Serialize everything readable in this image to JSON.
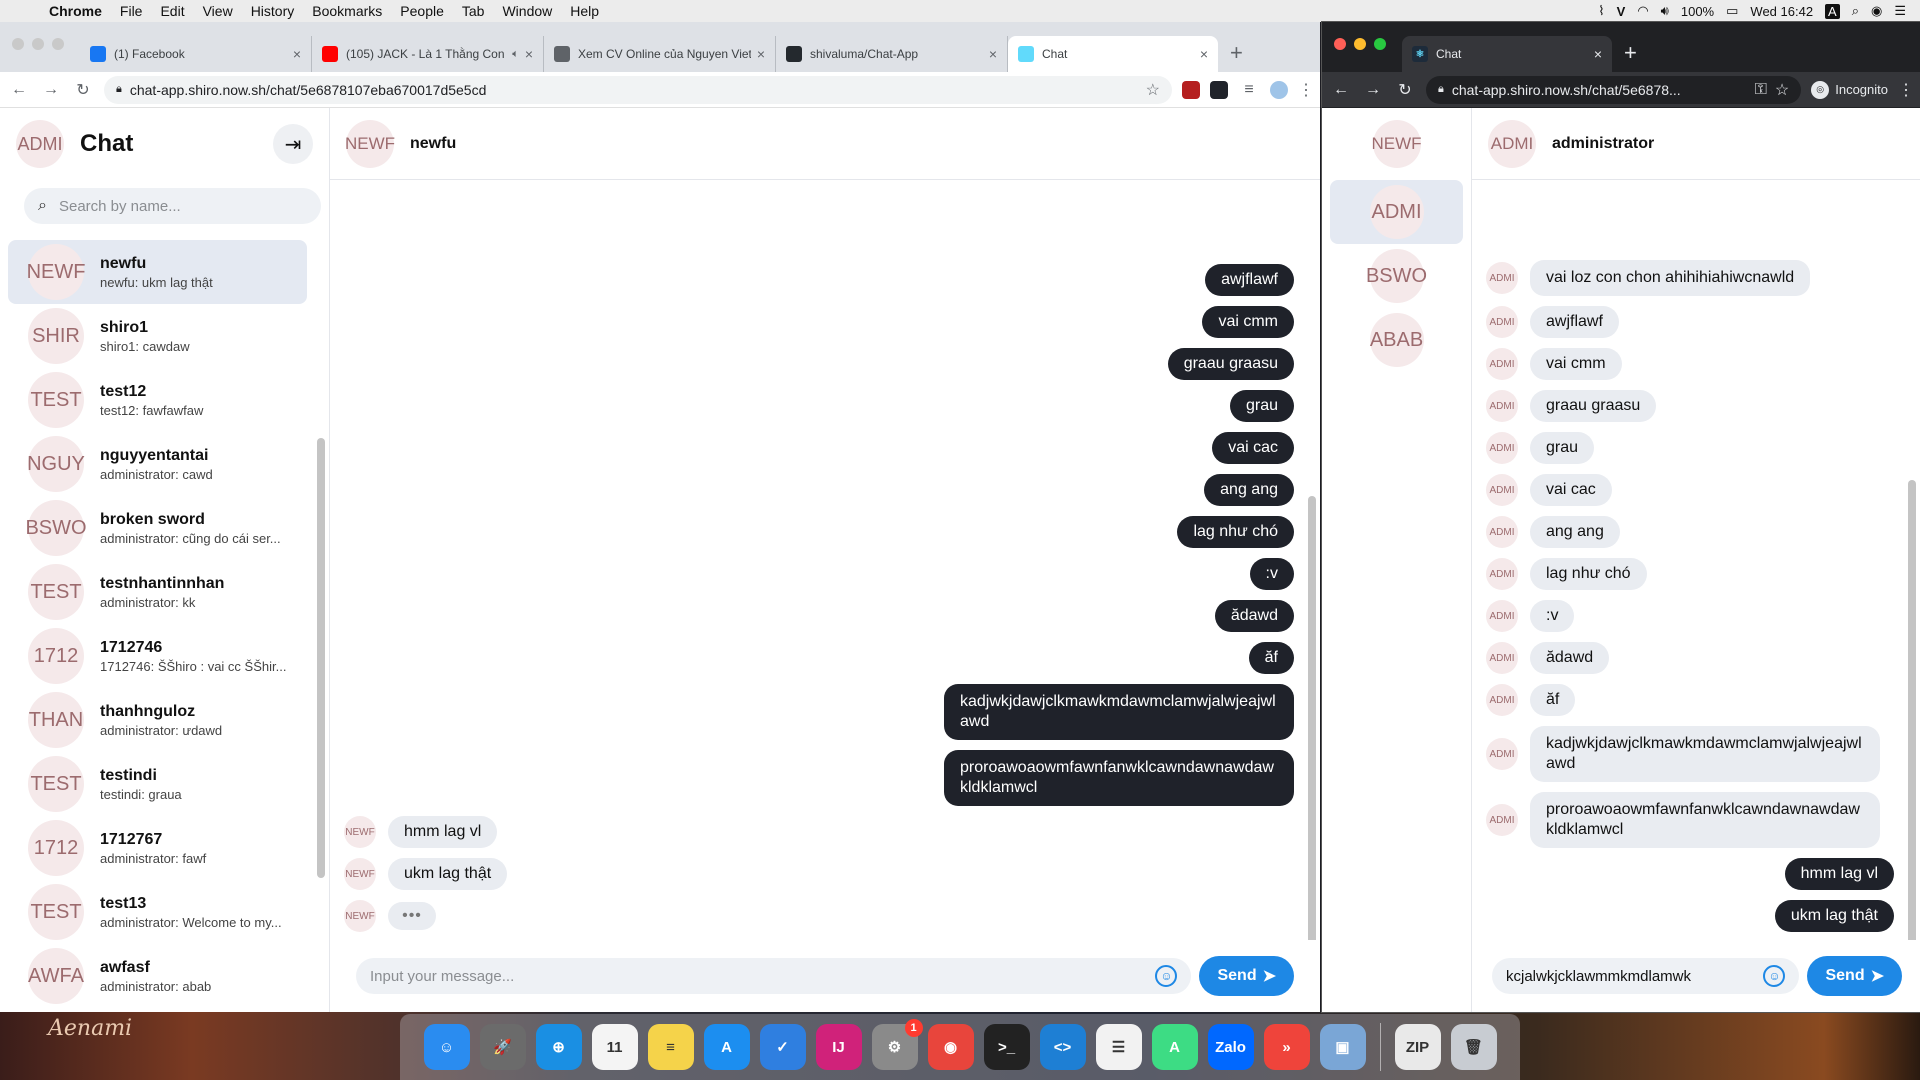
{
  "menubar": {
    "app": "Chrome",
    "items": [
      "File",
      "Edit",
      "View",
      "History",
      "Bookmarks",
      "People",
      "Tab",
      "Window",
      "Help"
    ],
    "battery": "100%",
    "clock": "Wed 16:42"
  },
  "wallpaper": {
    "signature": "Aenami"
  },
  "windowA": {
    "tabs": [
      {
        "title": "(1) Facebook",
        "icon": "facebook-icon",
        "color": "#1877f2"
      },
      {
        "title": "(105) JACK - Là 1 Thằng Con Trai",
        "icon": "youtube-icon",
        "color": "#ff0000"
      },
      {
        "title": "Xem CV Online của Nguyen Viet",
        "icon": "globe-icon",
        "color": "#5f6368"
      },
      {
        "title": "shivaluma/Chat-App",
        "icon": "github-icon",
        "color": "#24292e"
      },
      {
        "title": "Chat",
        "icon": "react-icon",
        "color": "#61dafb"
      }
    ],
    "url": "chat-app.shiro.now.sh/chat/5e6878107eba670017d5e5cd"
  },
  "windowB": {
    "tab": "Chat",
    "url": "chat-app.shiro.now.sh/chat/5e6878...",
    "incognito": "Incognito"
  },
  "appA": {
    "me": "ADMI",
    "title": "Chat",
    "search_placeholder": "Search by name...",
    "conversations": [
      {
        "avatar": "NEWF",
        "name": "newfu",
        "preview": "newfu: ukm lag thật"
      },
      {
        "avatar": "SHIR",
        "name": "shiro1",
        "preview": "shiro1: cawdaw"
      },
      {
        "avatar": "TEST",
        "name": "test12",
        "preview": "test12: fawfawfaw"
      },
      {
        "avatar": "NGUY",
        "name": "nguyyentantai",
        "preview": "administrator: cawd"
      },
      {
        "avatar": "BSWO",
        "name": "broken sword",
        "preview": "administrator: cũng do cái ser..."
      },
      {
        "avatar": "TEST",
        "name": "testnhantinnhan",
        "preview": "administrator: kk"
      },
      {
        "avatar": "1712",
        "name": "1712746",
        "preview": "1712746: ŠŠhiro : vai cc ŠŠhir..."
      },
      {
        "avatar": "THAN",
        "name": "thanhnguloz",
        "preview": "administrator: ưdawd"
      },
      {
        "avatar": "TEST",
        "name": "testindi",
        "preview": "testindi: graua"
      },
      {
        "avatar": "1712",
        "name": "1712767",
        "preview": "administrator: fawf"
      },
      {
        "avatar": "TEST",
        "name": "test13",
        "preview": "administrator: Welcome to my..."
      },
      {
        "avatar": "AWFA",
        "name": "awfasf",
        "preview": "administrator: abab"
      }
    ],
    "chat_avatar": "NEWF",
    "chat_name": "newfu",
    "messages": [
      {
        "dir": "out",
        "text": "awjflawf"
      },
      {
        "dir": "out",
        "text": "vai cmm"
      },
      {
        "dir": "out",
        "text": "graau graasu"
      },
      {
        "dir": "out",
        "text": "grau"
      },
      {
        "dir": "out",
        "text": "vai cac"
      },
      {
        "dir": "out",
        "text": "ang ang"
      },
      {
        "dir": "out",
        "text": "lag như chó"
      },
      {
        "dir": "out",
        "text": ":v"
      },
      {
        "dir": "out",
        "text": "ădawd"
      },
      {
        "dir": "out",
        "text": "ăf"
      },
      {
        "dir": "out",
        "text": "kadjwkjdawjclkmawkmdawmclamwjalwjeajwlawd"
      },
      {
        "dir": "out",
        "text": "proroawoaowmfawnfanwklcawndawnawdawkldklamwcl"
      },
      {
        "dir": "in",
        "avatar": "NEWF",
        "text": "hmm lag vl"
      },
      {
        "dir": "in",
        "avatar": "NEWF",
        "text": "ukm lag thật"
      }
    ],
    "typing_avatar": "NEWF",
    "typing": "•••",
    "input_placeholder": "Input your message...",
    "send": "Send"
  },
  "appB": {
    "me": "NEWF",
    "conversations": [
      "ADMI",
      "BSWO",
      "ABAB"
    ],
    "chat_avatar": "ADMI",
    "chat_name": "administrator",
    "messages": [
      {
        "dir": "in",
        "avatar": "ADMI",
        "text": "vai loz con chon ahihihiahiwcnawld"
      },
      {
        "dir": "in",
        "avatar": "ADMI",
        "text": "awjflawf"
      },
      {
        "dir": "in",
        "avatar": "ADMI",
        "text": "vai cmm"
      },
      {
        "dir": "in",
        "avatar": "ADMI",
        "text": "graau graasu"
      },
      {
        "dir": "in",
        "avatar": "ADMI",
        "text": "grau"
      },
      {
        "dir": "in",
        "avatar": "ADMI",
        "text": "vai cac"
      },
      {
        "dir": "in",
        "avatar": "ADMI",
        "text": "ang ang"
      },
      {
        "dir": "in",
        "avatar": "ADMI",
        "text": "lag như chó"
      },
      {
        "dir": "in",
        "avatar": "ADMI",
        "text": ":v"
      },
      {
        "dir": "in",
        "avatar": "ADMI",
        "text": "ădawd"
      },
      {
        "dir": "in",
        "avatar": "ADMI",
        "text": "ăf"
      },
      {
        "dir": "in",
        "avatar": "ADMI",
        "text": "kadjwkjdawjclkmawkmdawmclamwjalwjeajwlawd"
      },
      {
        "dir": "in",
        "avatar": "ADMI",
        "text": "proroawoaowmfawnfanwklcawndawnawdawkldklamwcl"
      },
      {
        "dir": "out",
        "text": "hmm lag vl"
      },
      {
        "dir": "out",
        "text": "ukm lag thật"
      }
    ],
    "input_value": "kcjalwkjcklawmmkmdlamwk",
    "send": "Send"
  },
  "dock": [
    {
      "name": "finder-icon",
      "label": "☺",
      "color": "#2a8cf0"
    },
    {
      "name": "launchpad-icon",
      "label": "🚀",
      "color": "#6b6b6b"
    },
    {
      "name": "safari-icon",
      "label": "⊕",
      "color": "#1a8fe3"
    },
    {
      "name": "calendar-icon",
      "label": "11",
      "color": "#f4f4f4"
    },
    {
      "name": "notes-icon",
      "label": "≡",
      "color": "#f5d34a"
    },
    {
      "name": "app-store-icon",
      "label": "A",
      "color": "#1c8ef0"
    },
    {
      "name": "tasks-icon",
      "label": "✓",
      "color": "#2f7fe0"
    },
    {
      "name": "intellij-icon",
      "label": "IJ",
      "color": "#d0227a"
    },
    {
      "name": "system-preferences-icon",
      "label": "⚙",
      "color": "#8a8a8a",
      "badge": "1"
    },
    {
      "name": "chrome-icon",
      "label": "◉",
      "color": "#e8453c"
    },
    {
      "name": "terminal-icon",
      "label": ">_",
      "color": "#222222"
    },
    {
      "name": "vscode-icon",
      "label": "<>",
      "color": "#1e7fd4"
    },
    {
      "name": "reminders-icon",
      "label": "☰",
      "color": "#f2f2f2"
    },
    {
      "name": "android-studio-icon",
      "label": "A",
      "color": "#3ddc84"
    },
    {
      "name": "zalo-icon",
      "label": "Zalo",
      "color": "#0068ff"
    },
    {
      "name": "anydesk-icon",
      "label": "»",
      "color": "#ef443b"
    },
    {
      "name": "preview-icon",
      "label": "▣",
      "color": "#7aa6d6"
    },
    {
      "name": "archive-icon",
      "label": "ZIP",
      "color": "#e9e9e9"
    },
    {
      "name": "trash-icon",
      "label": "🗑",
      "color": "#c8ccd2"
    }
  ]
}
